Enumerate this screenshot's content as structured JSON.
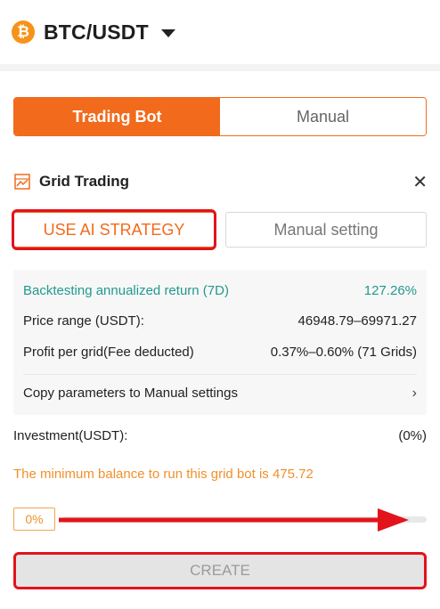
{
  "header": {
    "coin_symbol": "₿",
    "pair": "BTC/USDT",
    "dropdown_icon": "caret-down-icon"
  },
  "tabs": {
    "trading_bot": "Trading Bot",
    "manual": "Manual",
    "active": "Trading Bot"
  },
  "section": {
    "icon": "grid-chart-icon",
    "title": "Grid Trading",
    "close": "✕"
  },
  "strategy": {
    "ai_label": "USE AI STRATEGY",
    "manual_label": "Manual setting"
  },
  "info": {
    "backtest_label": "Backtesting annualized return (7D)",
    "backtest_value": "127.26%",
    "price_label": "Price range (USDT):",
    "price_value": "46948.79–69971.27",
    "profit_label": "Profit per grid(Fee deducted)",
    "profit_value": "0.37%–0.60% (71 Grids)",
    "copy_label": "Copy parameters to Manual settings",
    "chevron": "›"
  },
  "investment": {
    "label": "Investment(USDT):",
    "value": "(0%)"
  },
  "min_balance": "The minimum balance to run this grid bot is 475.72",
  "slider": {
    "percent_label": "0%",
    "level": 0
  },
  "create_label": "CREATE",
  "colors": {
    "accent": "#f26a1b",
    "teal": "#22998f",
    "warning": "#f0902a",
    "annotation_red": "#e3131b"
  }
}
